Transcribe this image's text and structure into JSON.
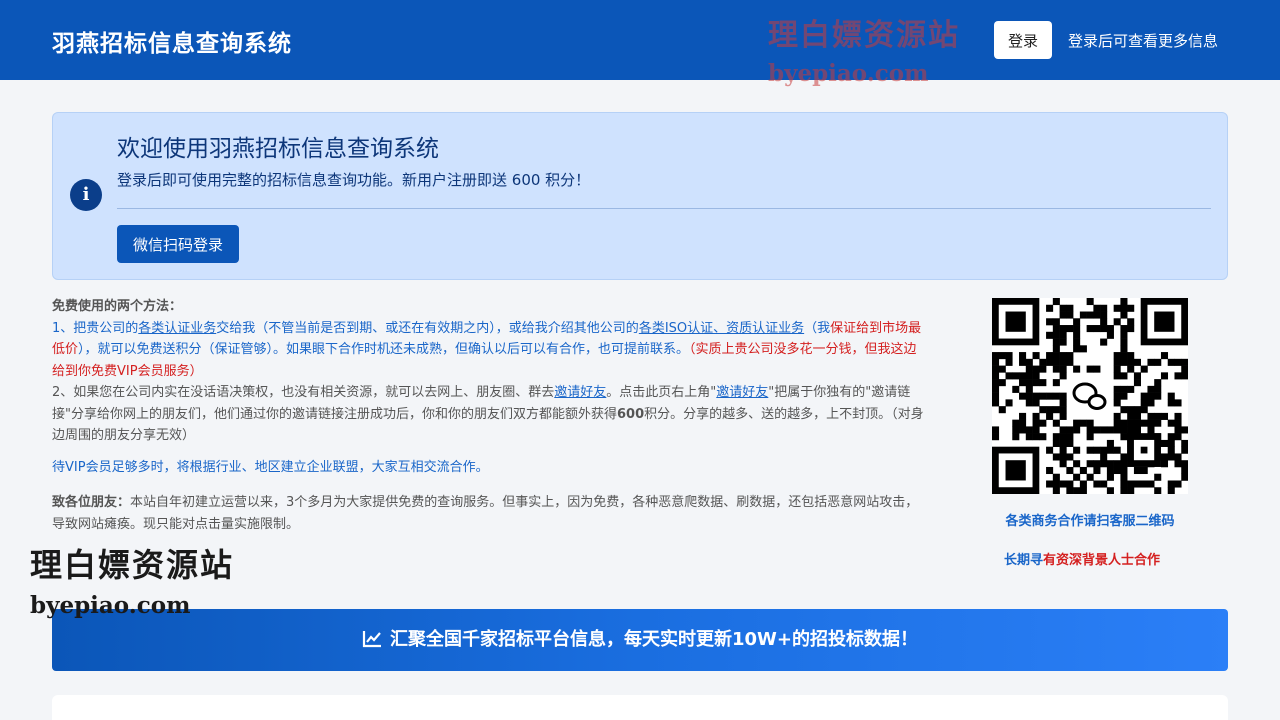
{
  "header": {
    "title": "羽燕招标信息查询系统",
    "login_label": "登录",
    "login_hint": "登录后可查看更多信息",
    "brand_color": "#0b56b8"
  },
  "watermark": {
    "cn": "理白嫖资源站",
    "en": "byepiao.com"
  },
  "welcome": {
    "icon": "info-icon",
    "title": "欢迎使用羽燕招标信息查询系统",
    "text": "登录后即可使用完整的招标信息查询功能。新用户注册即送 600 积分！",
    "wechat_button": "微信扫码登录"
  },
  "notice": {
    "heading": "免费使用的两个方法：",
    "m1_prefix": "1、把贵公司的",
    "m1_link1": "各类认证业务",
    "m1_mid1": "交给我（不管当前是否到期、或还在有效期之内），或给我介绍其他公司的",
    "m1_link2": "各类ISO认证、资质认证业务",
    "m1_mid2": "（我",
    "m1_red1": "保证给到市场最低价",
    "m1_mid3": "），就可以免费送积分（保证管够）。如果眼下合作时机还未成熟，但确认以后可以有合作，也可提前联系。",
    "m1_red2": "（实质上贵公司没多花一分钱，但我这边给到你免费VIP会员服务）",
    "m2_prefix": "2、如果您在公司内实在没话语决策权，也没有相关资源，就可以去网上、朋友圈、群去",
    "m2_link1": "邀请好友",
    "m2_mid1": "。点击此页右上角\"",
    "m2_link2": "邀请好友",
    "m2_mid2": "\"把属于你独有的\"邀请链接\"分享给你网上的朋友们，他们通过你的邀请链接注册成功后，你和你的朋友们双方都能额外获得",
    "m2_bold": "600",
    "m2_suffix": "积分。分享的越多、送的越多，上不封顶。（对身边周围的朋友分享无效）",
    "vip_line": "待VIP会员足够多时，将根据行业、地区建立企业联盟，大家互相交流合作。",
    "friends_label": "致各位朋友：",
    "friends_text": "本站自年初建立运营以来，3个多月为大家提供免费的查询服务。但事实上，因为免费，各种恶意爬数据、刷数据，还包括恶意网站攻击，导致网站瘫痪。现只能对点击量实施限制。"
  },
  "qr": {
    "icon": "wechat-icon",
    "caption": "各类商务合作请扫客服二维码",
    "partner_blue": "长期寻",
    "partner_red": "有资深背景人士合作"
  },
  "banner": {
    "icon": "chart-line-icon",
    "text": "汇聚全国千家招标平台信息，每天实时更新10W+的招投标数据！"
  },
  "bottom": {
    "left_label": "...",
    "right_label": "..."
  }
}
